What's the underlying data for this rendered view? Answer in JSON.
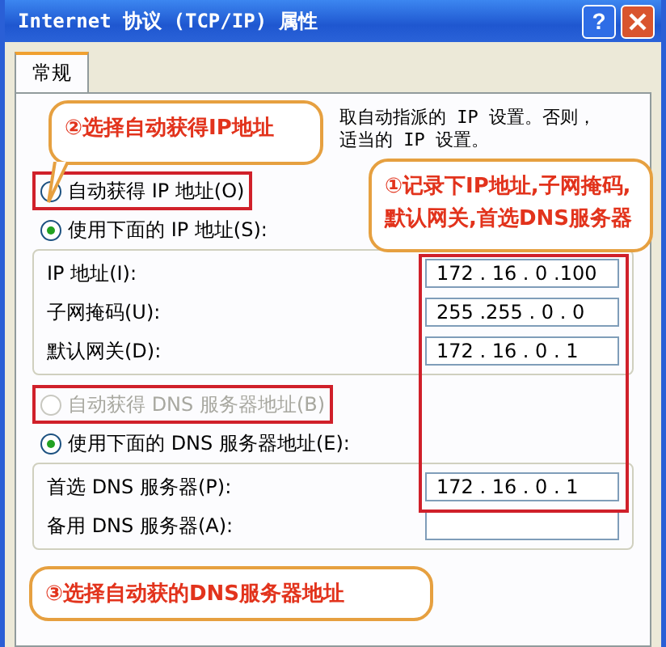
{
  "window": {
    "title": "Internet 协议 (TCP/IP) 属性",
    "buttons": [
      {
        "kind": "help",
        "label": "?"
      },
      {
        "kind": "close"
      }
    ]
  },
  "tabs": [
    {
      "label": "常规",
      "selected": true
    }
  ],
  "intro": [
    "取自动指派的 IP 设置。否则，",
    "适当的 IP 设置。"
  ],
  "ip_mode": [
    {
      "label": "自动获得 IP 地址(O)",
      "selected": false,
      "highlighted": true
    },
    {
      "label": "使用下面的 IP 地址(S):",
      "selected": true,
      "highlighted": false
    }
  ],
  "ip_fields": [
    {
      "label": "IP 地址(I):",
      "value": "172 . 16 . 0 .100"
    },
    {
      "label": "子网掩码(U):",
      "value": "255 .255 . 0 . 0"
    },
    {
      "label": "默认网关(D):",
      "value": "172 . 16 . 0 . 1"
    }
  ],
  "dns_mode": [
    {
      "label": "自动获得 DNS 服务器地址(B)",
      "selected": false,
      "disabled": true,
      "highlighted": true
    },
    {
      "label": "使用下面的 DNS 服务器地址(E):",
      "selected": true,
      "disabled": false,
      "highlighted": false
    }
  ],
  "dns_fields": [
    {
      "label": "首选 DNS 服务器(P):",
      "value": "172 . 16 . 0 . 1"
    },
    {
      "label": "备用 DNS 服务器(A):"
    }
  ],
  "callouts": [
    "②选择自动获得IP地址",
    "①记录下IP地址,子网掩码,默认网关,首选DNS服务器",
    "③选择自动获的DNS服务器地址"
  ]
}
